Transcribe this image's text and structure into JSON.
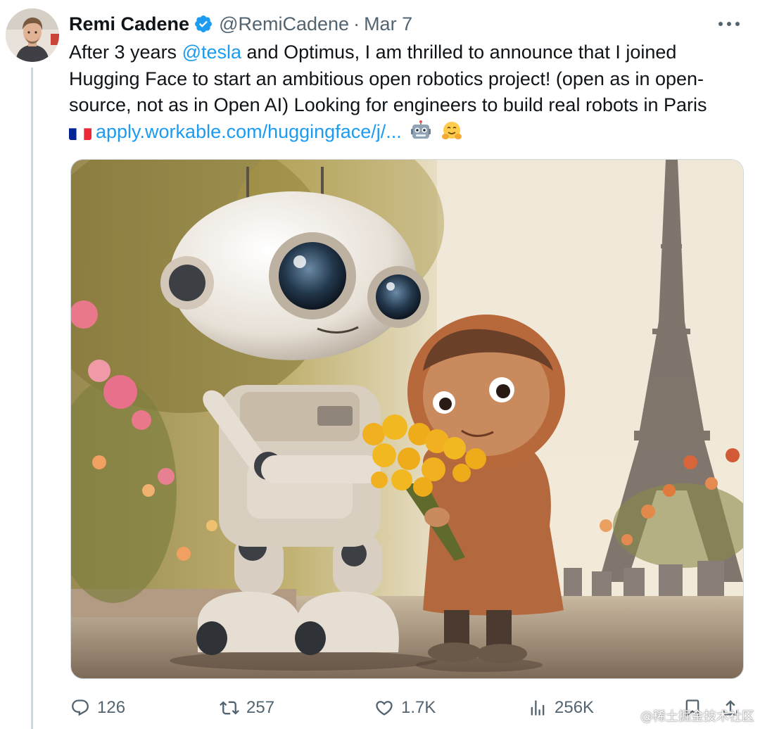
{
  "author": {
    "name": "Remi Cadene",
    "handle": "@RemiCadene",
    "separator": "·",
    "date": "Mar 7"
  },
  "tweet": {
    "line1_a": "After 3 years ",
    "mention": "@tesla",
    "line1_b": " and Optimus, I am thrilled to announce that I joined",
    "line2": "Hugging Face to start an ambitious open robotics project! (open as in open-",
    "line3": "source, not as in Open AI) Looking for engineers to build real robots in Paris",
    "link": "apply.workable.com/huggingface/j/...",
    "emojis": [
      "flag-france-icon",
      "robot-face-icon",
      "hugging-face-icon"
    ]
  },
  "media": {
    "subject": "robot-and-child-with-flowers-eiffel-tower-image"
  },
  "actions": {
    "replies": "126",
    "retweets": "257",
    "likes": "1.7K",
    "views": "256K"
  },
  "watermark": "@稀土掘金技术社区",
  "colors": {
    "link": "#1d9bf0",
    "secondary_text": "#536471",
    "verified_badge": "#1d9bf0"
  }
}
